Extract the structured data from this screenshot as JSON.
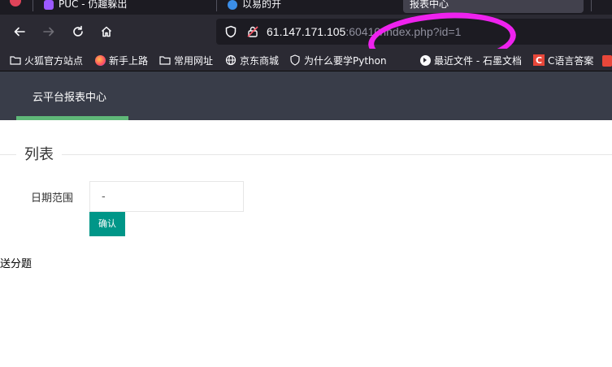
{
  "browser": {
    "tabs": [
      {
        "label": "PUC - 仍趣躲出",
        "active": false
      },
      {
        "label": "以易的开",
        "active": false
      },
      {
        "label": "报表中心",
        "active": true
      }
    ],
    "url": {
      "host": "61.147.171.105",
      "rest": ":60410/index.php?id=1"
    },
    "bookmarks": [
      {
        "label": "火狐官方站点",
        "icon": "folder-icon"
      },
      {
        "label": "新手上路",
        "icon": "firefox-icon"
      },
      {
        "label": "常用网址",
        "icon": "folder-icon"
      },
      {
        "label": "京东商城",
        "icon": "globe-icon"
      },
      {
        "label": "为什么要学Python",
        "icon": "shield-icon"
      },
      {
        "label": "最近文件 - 石墨文档",
        "icon": "shimo-icon"
      },
      {
        "label": "C语言答案",
        "icon": "c-icon"
      }
    ],
    "annotation_color": "#ee22ee"
  },
  "header": {
    "nav_label": "云平台报表中心",
    "bg_color": "#393d49",
    "indicator_color": "#5fb878"
  },
  "main": {
    "section_title": "列表",
    "date_label": "日期范围",
    "date_value": "-",
    "confirm_label": "确认",
    "confirm_color": "#009688",
    "bottom_text": "送分题"
  }
}
